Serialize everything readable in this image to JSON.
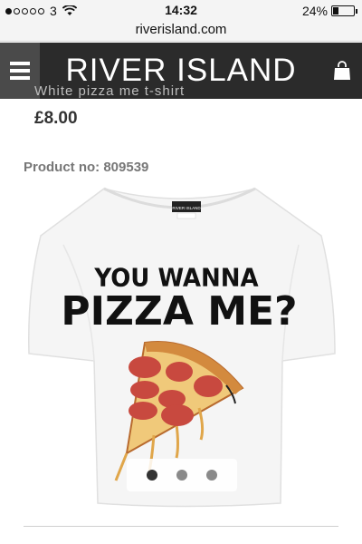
{
  "status_bar": {
    "carrier": "3",
    "time": "14:32",
    "battery_text": "24%",
    "battery_level": 0.24,
    "signal_bars_filled": 1,
    "signal_bars_total": 5
  },
  "browser": {
    "url": "riverisland.com"
  },
  "header": {
    "brand": "RIVER ISLAND",
    "menu_icon": "hamburger-icon",
    "bag_icon": "shopping-bag-icon",
    "background": "#2b2b2b"
  },
  "product": {
    "ghost_title": "White pizza me t-shirt",
    "price": "£8.00",
    "product_no_label": "Product no:",
    "product_no_value": "809539",
    "image": {
      "graphic_text_line1": "YOU WANNA",
      "graphic_text_line2": "PIZZA ME?",
      "neck_label": "RIVER ISLAND"
    },
    "carousel": {
      "count": 3,
      "active_index": 0
    }
  }
}
